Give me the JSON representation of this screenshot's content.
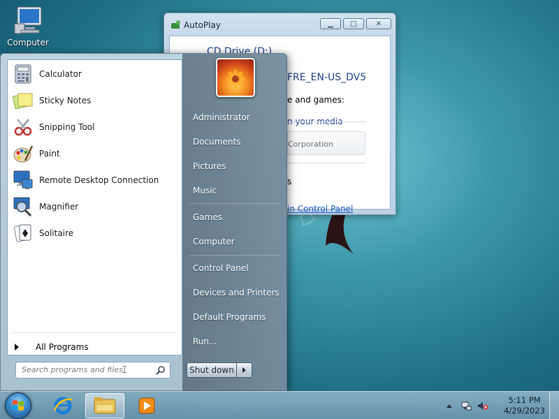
{
  "desktop": {
    "icons": [
      {
        "label": "Computer",
        "icon": "computer-icon"
      }
    ]
  },
  "autoplay": {
    "title": "AutoPlay",
    "drive_title": "CD Drive (D:)",
    "volume_label": "FRE_EN-US_DV5",
    "section_label": "e and games:",
    "media_option": "n your media",
    "option_publisher": "Corporation",
    "general_options": "s",
    "control_panel_link": "in Control Panel"
  },
  "start_menu": {
    "programs": [
      {
        "label": "Calculator",
        "icon": "calculator-icon"
      },
      {
        "label": "Sticky Notes",
        "icon": "sticky-notes-icon"
      },
      {
        "label": "Snipping Tool",
        "icon": "scissors-icon"
      },
      {
        "label": "Paint",
        "icon": "paint-palette-icon"
      },
      {
        "label": "Remote Desktop Connection",
        "icon": "remote-desktop-icon"
      },
      {
        "label": "Magnifier",
        "icon": "magnifier-icon"
      },
      {
        "label": "Solitaire",
        "icon": "cards-icon"
      }
    ],
    "all_programs": "All Programs",
    "search_placeholder": "Search programs and files",
    "right": {
      "links": [
        "Administrator",
        "Documents",
        "Pictures",
        "Music",
        "Games",
        "Computer",
        "Control Panel",
        "Devices and Printers",
        "Default Programs",
        "Run..."
      ]
    },
    "shutdown_label": "Shut down"
  },
  "taskbar": {
    "pinned": [
      "internet-explorer-icon",
      "windows-explorer-icon",
      "media-player-icon"
    ],
    "clock_time": "5:11 PM",
    "clock_date": "4/29/2023",
    "tray_icons": [
      "network-icon",
      "volume-muted-icon"
    ]
  }
}
